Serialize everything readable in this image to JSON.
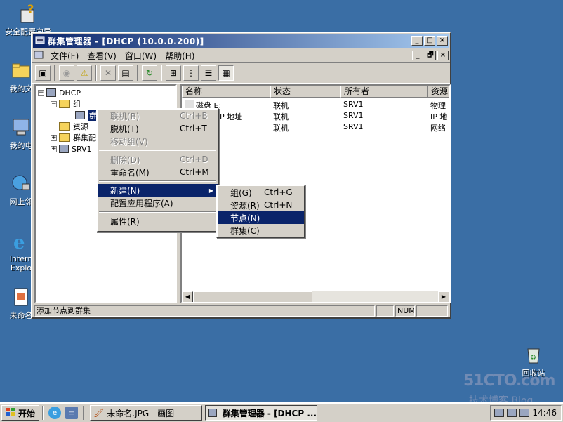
{
  "desktop": {
    "icons": [
      {
        "label": "安全配置向导",
        "icon": "security-wizard-icon"
      },
      {
        "label": "我的文",
        "icon": "my-documents-icon"
      },
      {
        "label": "我的电",
        "icon": "my-computer-icon"
      },
      {
        "label": "网上邻",
        "icon": "network-places-icon"
      },
      {
        "label": "Intern",
        "icon": "internet-explorer-icon"
      },
      {
        "label": "Explo",
        "icon": "internet-explorer-icon"
      },
      {
        "label": "未命名",
        "icon": "image-file-icon"
      },
      {
        "label": "回收站",
        "icon": "recycle-bin-icon"
      }
    ]
  },
  "window": {
    "title": "群集管理器 - [DHCP (10.0.0.200)]",
    "controls": {
      "minimize": "_",
      "maximize": "□",
      "close": "×",
      "restore": "🗗"
    },
    "menu": [
      "文件(F)",
      "查看(V)",
      "窗口(W)",
      "帮助(H)"
    ],
    "tree": {
      "root": "DHCP",
      "group": "组",
      "group_child": "群",
      "resources": "资源",
      "cluster_config": "群集配",
      "node": "SRV1",
      "collapse": "−",
      "expand": "+"
    },
    "list": {
      "columns": [
        "名称",
        "状态",
        "所有者",
        "资源"
      ],
      "rows": [
        [
          "磁盘 E:",
          "联机",
          "SRV1",
          "物理"
        ],
        [
          "P 地址",
          "联机",
          "SRV1",
          "IP 地"
        ],
        [
          "",
          "联机",
          "SRV1",
          "网络"
        ]
      ]
    },
    "status": {
      "text": "添加节点到群集",
      "num": "NUM"
    }
  },
  "context_menu": {
    "items": [
      {
        "label": "联机(B)",
        "accel": "Ctrl+B",
        "disabled": true
      },
      {
        "label": "脱机(T)",
        "accel": "Ctrl+T",
        "disabled": false
      },
      {
        "label": "移动组(V)",
        "accel": "",
        "disabled": true
      },
      {
        "label": "删除(D)",
        "accel": "Ctrl+D",
        "disabled": true
      },
      {
        "label": "重命名(M)",
        "accel": "Ctrl+M",
        "disabled": false
      },
      {
        "label": "新建(N)",
        "accel": "",
        "selected": true
      },
      {
        "label": "配置应用程序(A)",
        "accel": ""
      },
      {
        "label": "属性(R)",
        "accel": ""
      }
    ]
  },
  "submenu": {
    "items": [
      {
        "label": "组(G)",
        "accel": "Ctrl+G"
      },
      {
        "label": "资源(R)",
        "accel": "Ctrl+N"
      },
      {
        "label": "节点(N)",
        "accel": "",
        "selected": true
      },
      {
        "label": "群集(C)",
        "accel": ""
      }
    ]
  },
  "taskbar": {
    "start": "开始",
    "tasks": [
      {
        "label": "未命名.JPG - 画图",
        "active": false
      },
      {
        "label": "群集管理器 - [DHCP ...",
        "active": true
      }
    ],
    "clock": "14:46"
  },
  "watermark": {
    "line1": "51CTO.com",
    "line2": "技术博客 Blog"
  }
}
